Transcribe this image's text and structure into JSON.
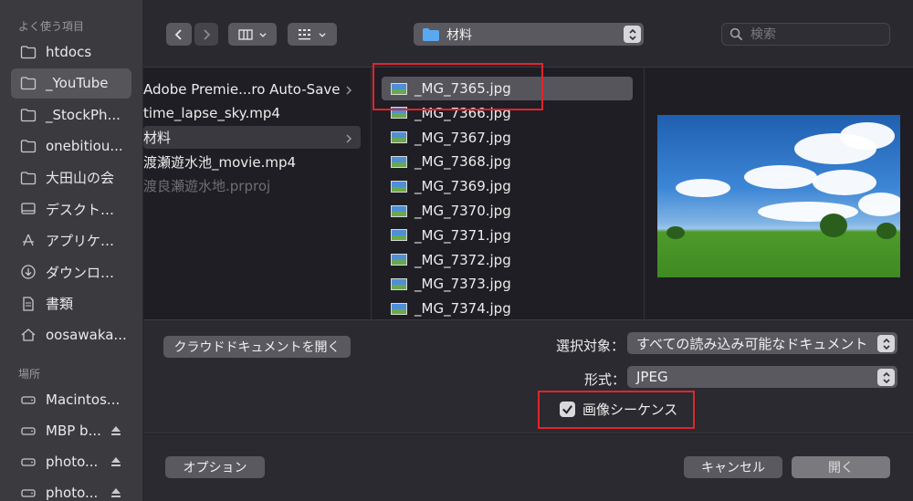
{
  "sidebar": {
    "favorites_heading": "よく使う項目",
    "favorites": [
      {
        "label": "htdocs",
        "icon": "folder-icon",
        "selected": false
      },
      {
        "label": "_YouTube",
        "icon": "folder-icon",
        "selected": true
      },
      {
        "label": "_StockPh...",
        "icon": "folder-icon",
        "selected": false
      },
      {
        "label": "onebitiou...",
        "icon": "folder-icon",
        "selected": false
      },
      {
        "label": "大田山の会",
        "icon": "folder-icon",
        "selected": false
      },
      {
        "label": "デスクト…",
        "icon": "desktop-icon",
        "selected": false
      },
      {
        "label": "アプリケ…",
        "icon": "applications-icon",
        "selected": false
      },
      {
        "label": "ダウンロ…",
        "icon": "download-icon",
        "selected": false
      },
      {
        "label": "書類",
        "icon": "document-icon",
        "selected": false
      },
      {
        "label": "oosawaka...",
        "icon": "home-icon",
        "selected": false
      }
    ],
    "locations_heading": "場所",
    "locations": [
      {
        "label": "Macintos...",
        "icon": "disk-icon",
        "eject": false
      },
      {
        "label": "MBP b...",
        "icon": "disk-icon",
        "eject": true
      },
      {
        "label": "photo...",
        "icon": "disk-icon",
        "eject": true
      },
      {
        "label": "photo...",
        "icon": "disk-icon",
        "eject": true
      }
    ]
  },
  "toolbar": {
    "path_label": "材料",
    "search_placeholder": "検索"
  },
  "column1": [
    {
      "label": "Adobe Premie...ro Auto-Save",
      "chevron": true,
      "selected": false,
      "dim": false
    },
    {
      "label": "time_lapse_sky.mp4",
      "chevron": false,
      "selected": false,
      "dim": false
    },
    {
      "label": "材料",
      "chevron": true,
      "selected": true,
      "dim": false
    },
    {
      "label": "渡瀬遊水池_movie.mp4",
      "chevron": false,
      "selected": false,
      "dim": false
    },
    {
      "label": "渡良瀬遊水地.prproj",
      "chevron": false,
      "selected": false,
      "dim": true
    }
  ],
  "column2": [
    {
      "label": "_MG_7365.jpg",
      "selected": true
    },
    {
      "label": "_MG_7366.jpg",
      "selected": false
    },
    {
      "label": "_MG_7367.jpg",
      "selected": false
    },
    {
      "label": "_MG_7368.jpg",
      "selected": false
    },
    {
      "label": "_MG_7369.jpg",
      "selected": false
    },
    {
      "label": "_MG_7370.jpg",
      "selected": false
    },
    {
      "label": "_MG_7371.jpg",
      "selected": false
    },
    {
      "label": "_MG_7372.jpg",
      "selected": false
    },
    {
      "label": "_MG_7373.jpg",
      "selected": false
    },
    {
      "label": "_MG_7374.jpg",
      "selected": false
    }
  ],
  "options": {
    "cloud_button": "クラウドドキュメントを開く",
    "enable_label": "選択対象：",
    "enable_value": "すべての読み込み可能なドキュメント",
    "format_label": "形式：",
    "format_value": "JPEG",
    "sequence_label": "画像シーケンス",
    "sequence_checked": true
  },
  "bottom": {
    "options_button": "オプション",
    "cancel_button": "キャンセル",
    "open_button": "開く"
  },
  "colors": {
    "highlight": "#e0252a",
    "selection": "#56555b"
  }
}
